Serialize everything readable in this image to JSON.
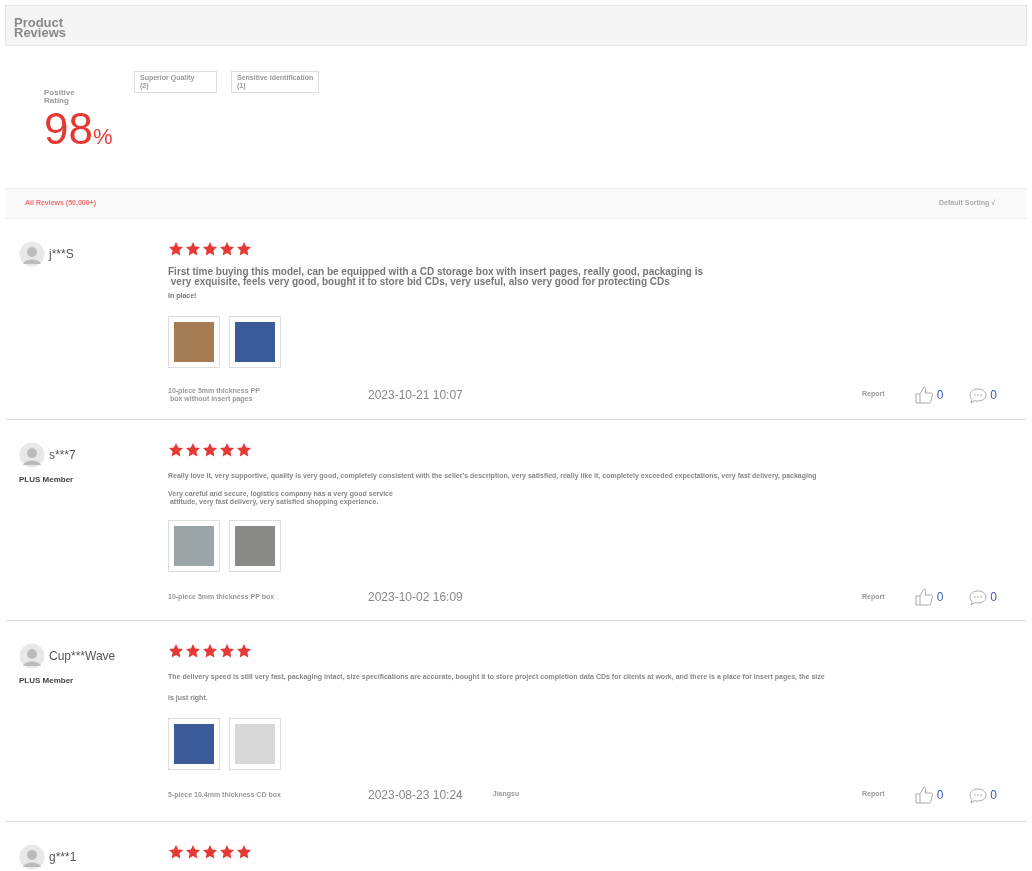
{
  "header": {
    "title": "Product\nReviews"
  },
  "summary": {
    "label": "Positive\nRating",
    "value": "98",
    "unit": "%",
    "tags": [
      {
        "label": "Superior Quality",
        "count": "(2)"
      },
      {
        "label": "Sensitive Identification",
        "count": "(1)"
      }
    ]
  },
  "filter_bar": {
    "all_reviews": "All Reviews (50,000+)",
    "sorting": "Default Sorting √"
  },
  "reviews": [
    {
      "user": "j***S",
      "stars": 5,
      "paragraphs": [
        "First time buying this model, can be equipped with a CD storage box with insert pages, really good, packaging is\n very exquisite, feels very good, bought it to store bid CDs, very useful, also very good for protecting CDs",
        "In place!"
      ],
      "photos": [
        {
          "color": "#a67c52"
        },
        {
          "color": "#3a5a9a"
        }
      ],
      "variant": "10-piece 5mm thickness PP\n box without insert pages",
      "date": "2023-10-21 10:07",
      "report": "Report",
      "likes": "0",
      "comments": "0"
    },
    {
      "user": "s***7",
      "member": "PLUS Member",
      "stars": 5,
      "paragraphs": [
        "Really love it, very supportive, quality is very good, completely consistent with the seller's description, very satisfied, really like it, completely exceeded expectations, very fast delivery, packaging",
        "Very careful and secure, logistics company has a very good service\n attitude, very fast delivery, very satisfied shopping experience."
      ],
      "photos": [
        {
          "color": "#9aa5a8"
        },
        {
          "color": "#8a8a88"
        }
      ],
      "variant": "10-piece 5mm thickness PP box",
      "date": "2023-10-02 16:09",
      "report": "Report",
      "likes": "0",
      "comments": "0"
    },
    {
      "user": "Cup***Wave",
      "member": "PLUS Member",
      "stars": 5,
      "paragraphs": [
        "The delivery speed is still very fast, packaging intact, size specifications are accurate, bought it to store project completion data CDs for clients at work, and there is a place for insert pages, the size",
        "is just right."
      ],
      "photos": [
        {
          "color": "#3a5a9a"
        },
        {
          "color": "#d8d8d8"
        }
      ],
      "variant": "5-piece 10.4mm thickness CD box",
      "date": "2023-08-23 10:24",
      "location": "Jiangsu",
      "report": "Report",
      "likes": "0",
      "comments": "0"
    },
    {
      "user": "g***1",
      "stars": 5
    }
  ]
}
